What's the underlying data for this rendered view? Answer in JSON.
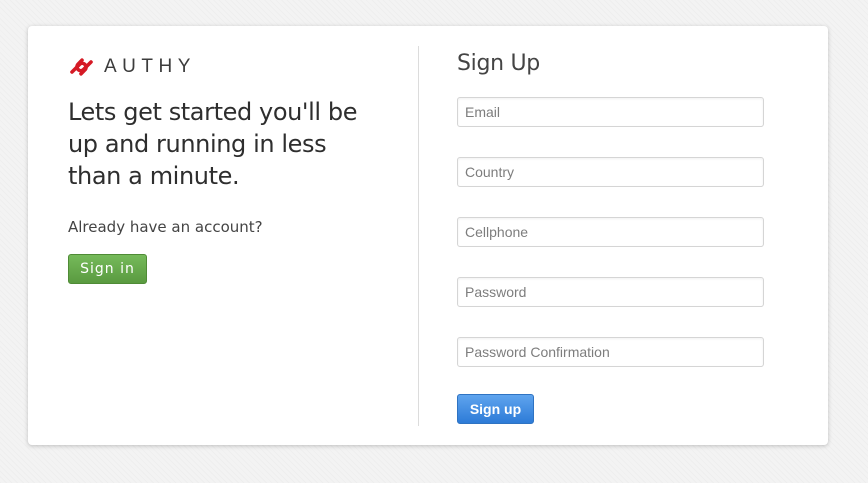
{
  "brand": {
    "name": "AUTHY",
    "logo_icon": "authy-logo-icon",
    "logo_color": "#d51a25"
  },
  "intro": {
    "headline": "Lets get started you'll be up and running in less than a minute.",
    "already_account": "Already have an account?",
    "signin_label": "Sign in"
  },
  "signup": {
    "title": "Sign Up",
    "fields": {
      "email": {
        "placeholder": "Email",
        "value": ""
      },
      "country": {
        "placeholder": "Country",
        "value": ""
      },
      "cellphone": {
        "placeholder": "Cellphone",
        "value": ""
      },
      "password": {
        "placeholder": "Password",
        "value": ""
      },
      "password_confirmation": {
        "placeholder": "Password Confirmation",
        "value": ""
      }
    },
    "submit_label": "Sign up"
  },
  "colors": {
    "signin_button": "#66a84a",
    "signup_button": "#3d8ae0"
  }
}
